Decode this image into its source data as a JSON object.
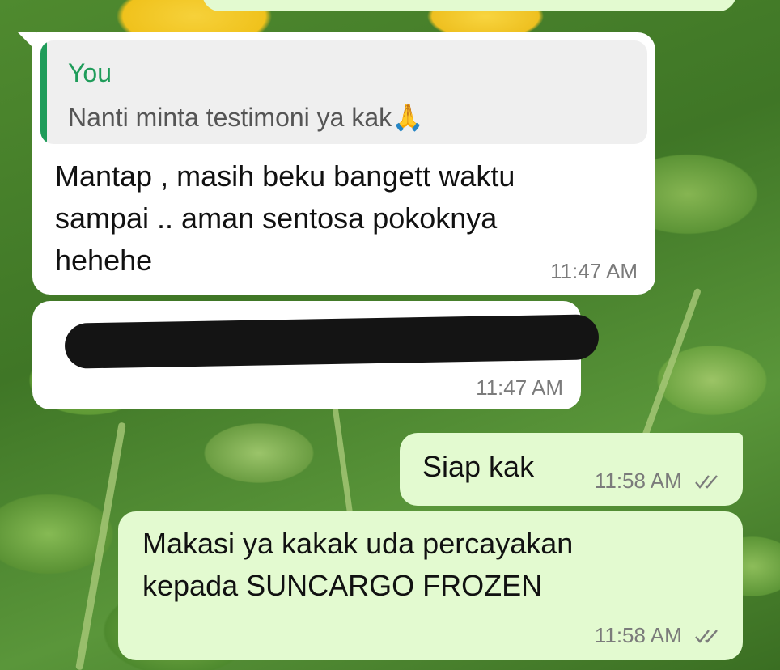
{
  "messages": [
    {
      "quote": {
        "author": "You",
        "text": "Nanti minta testimoni ya kak🙏"
      },
      "text_lines": [
        "Mantap , masih beku bangett waktu",
        "sampai .. aman sentosa pokoknya",
        "hehehe"
      ],
      "time": "11:47 AM"
    },
    {
      "time": "11:47 AM"
    },
    {
      "text": "Siap kak",
      "time": "11:58 AM"
    },
    {
      "text_lines": [
        "Makasi ya kakak uda percayakan",
        "kepada SUNCARGO FROZEN"
      ],
      "time": "11:58 AM"
    }
  ],
  "colors": {
    "incoming": "#ffffff",
    "outgoing": "#e3fad0",
    "quote_accent": "#1f9c5a",
    "time": "#7b7b7b"
  },
  "icons": {
    "read_receipt": "double-check-icon"
  }
}
